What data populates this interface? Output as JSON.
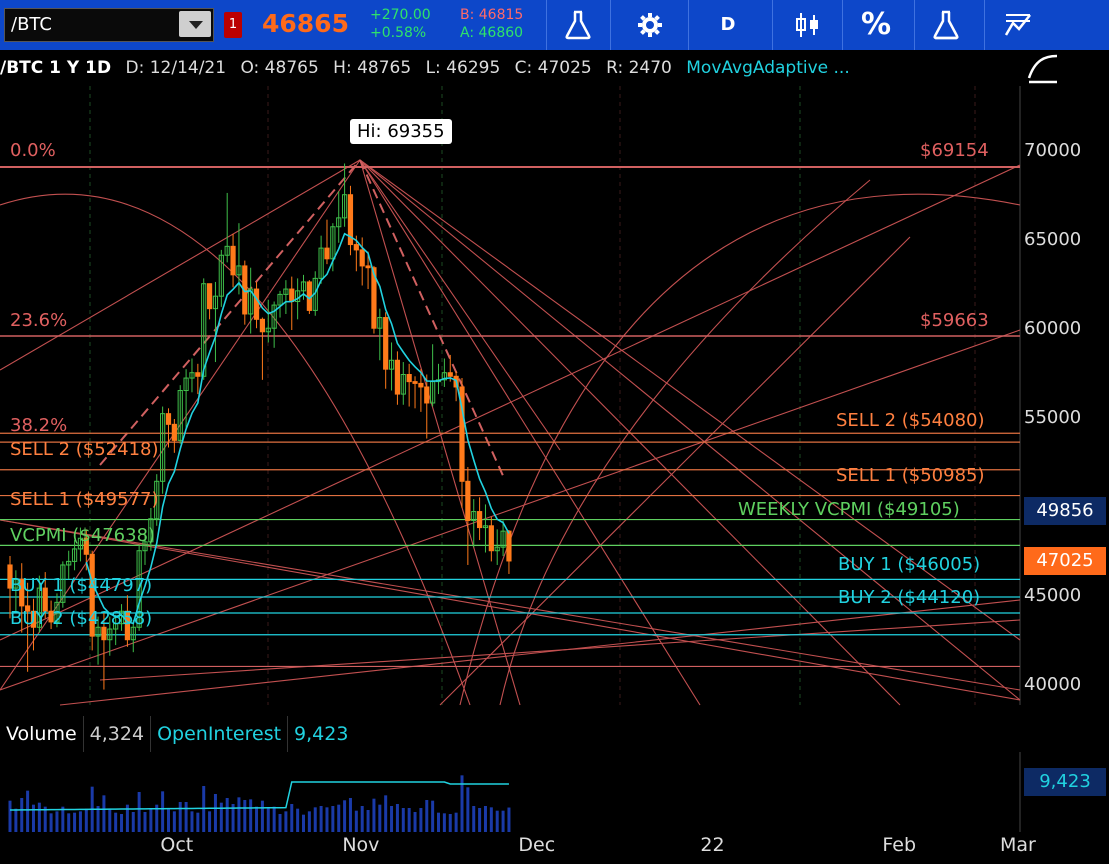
{
  "toolbar": {
    "symbol": "/BTC",
    "alert_badge": "1",
    "last_price": "46865",
    "net_change": "+270.00",
    "net_change_pct": "+0.58%",
    "bid": "B: 46815",
    "ask": "A: 46860",
    "aggregation": "D",
    "percent_label": "%",
    "accent": "#0d47c9",
    "price_color": "#ff6a1a",
    "change_color": "#2ee36a"
  },
  "infobar": {
    "symbol_period": "/BTC 1 Y 1D",
    "date": "D: 12/14/21",
    "open": "O: 48765",
    "high": "H: 48765",
    "low": "L: 46295",
    "close": "C: 47025",
    "range": "R: 2470",
    "study": "MovAvgAdaptive ..."
  },
  "price_tags": {
    "current": "47025",
    "current_color": "#ff6a1a",
    "weekly_vcpmi": "49856",
    "weekly_vcpmi_color": "#0d2a64"
  },
  "volume_panel": {
    "label": "Volume",
    "value": "4,324",
    "oi_label": "OpenInterest",
    "oi_value": "9,423",
    "oi_tag": "9,423"
  },
  "time_axis": [
    "Oct",
    "Nov",
    "Dec",
    "22",
    "Feb",
    "Mar"
  ],
  "tooltip": {
    "hi": "Hi: 69355"
  },
  "chart_data": {
    "type": "candlestick",
    "ylim": [
      38500,
      72000
    ],
    "y_ticks": [
      "70000",
      "65000",
      "60000",
      "55000",
      "50000",
      "45000",
      "40000"
    ],
    "start_date": "2021-09-03",
    "x_end_date": "2022-03-01",
    "candles": [
      [
        46800,
        47300,
        43800,
        45500
      ],
      [
        45500,
        46500,
        44200,
        46000
      ],
      [
        46000,
        46900,
        43000,
        44500
      ],
      [
        44500,
        45800,
        40800,
        44200
      ],
      [
        44200,
        44900,
        42000,
        43300
      ],
      [
        43300,
        46200,
        43000,
        45500
      ],
      [
        45500,
        46400,
        43800,
        44200
      ],
      [
        44200,
        44800,
        43200,
        43600
      ],
      [
        43600,
        45200,
        43300,
        44700
      ],
      [
        44700,
        47000,
        44400,
        46800
      ],
      [
        46800,
        47600,
        46000,
        47000
      ],
      [
        47000,
        48200,
        46500,
        47700
      ],
      [
        47700,
        48900,
        47000,
        48300
      ],
      [
        48300,
        48800,
        46500,
        47400
      ],
      [
        47400,
        47600,
        42000,
        42800
      ],
      [
        42800,
        43900,
        41200,
        43300
      ],
      [
        43300,
        44100,
        39800,
        42600
      ],
      [
        42600,
        43900,
        41700,
        43200
      ],
      [
        43200,
        44000,
        42300,
        43500
      ],
      [
        43500,
        44600,
        43100,
        44200
      ],
      [
        44200,
        45100,
        42200,
        42600
      ],
      [
        42600,
        43700,
        41900,
        43300
      ],
      [
        43300,
        47900,
        43100,
        47600
      ],
      [
        47600,
        48600,
        46800,
        48100
      ],
      [
        48100,
        50000,
        47600,
        49400
      ],
      [
        49400,
        51900,
        49000,
        51500
      ],
      [
        51500,
        55700,
        50800,
        55300
      ],
      [
        55300,
        55600,
        53400,
        54700
      ],
      [
        54700,
        55000,
        53100,
        53800
      ],
      [
        53800,
        56900,
        53600,
        56600
      ],
      [
        56600,
        57800,
        54500,
        57300
      ],
      [
        57300,
        58400,
        56500,
        57600
      ],
      [
        57600,
        58100,
        56400,
        57400
      ],
      [
        57400,
        62900,
        57200,
        62600
      ],
      [
        62600,
        62500,
        60600,
        61200
      ],
      [
        61200,
        62700,
        58200,
        61900
      ],
      [
        61900,
        64500,
        61300,
        64200
      ],
      [
        64200,
        67700,
        63800,
        64700
      ],
      [
        64700,
        65400,
        62400,
        63100
      ],
      [
        63100,
        66000,
        62000,
        63600
      ],
      [
        63600,
        63900,
        60300,
        60900
      ],
      [
        60900,
        63500,
        59800,
        62300
      ],
      [
        62300,
        62700,
        60100,
        60600
      ],
      [
        60600,
        60700,
        57200,
        59900
      ],
      [
        59900,
        61700,
        59300,
        60100
      ],
      [
        60100,
        61600,
        59000,
        61400
      ],
      [
        61400,
        62200,
        60700,
        62000
      ],
      [
        62000,
        62800,
        60900,
        62300
      ],
      [
        62300,
        63000,
        60000,
        61600
      ],
      [
        61600,
        62900,
        60600,
        62200
      ],
      [
        62200,
        63100,
        61700,
        62700
      ],
      [
        62700,
        62800,
        60900,
        61100
      ],
      [
        61100,
        63300,
        60800,
        62900
      ],
      [
        62900,
        65300,
        62600,
        64600
      ],
      [
        64600,
        66200,
        63700,
        64000
      ],
      [
        64000,
        66000,
        63300,
        65800
      ],
      [
        65800,
        67800,
        64900,
        66300
      ],
      [
        66300,
        69355,
        65800,
        67600
      ],
      [
        67600,
        68100,
        64200,
        64800
      ],
      [
        64800,
        65300,
        63300,
        64500
      ],
      [
        64500,
        65200,
        62500,
        63600
      ],
      [
        63600,
        64400,
        62300,
        63500
      ],
      [
        63500,
        63600,
        59800,
        60100
      ],
      [
        60100,
        61200,
        58300,
        60700
      ],
      [
        60700,
        61000,
        56700,
        57800
      ],
      [
        57800,
        59300,
        56600,
        58300
      ],
      [
        58300,
        58800,
        55800,
        56400
      ],
      [
        56400,
        58200,
        55800,
        57500
      ],
      [
        57500,
        58100,
        55700,
        57100
      ],
      [
        57100,
        57400,
        55600,
        57000
      ],
      [
        57000,
        57800,
        55400,
        56800
      ],
      [
        56800,
        57500,
        53900,
        55900
      ],
      [
        55900,
        59200,
        55700,
        57100
      ],
      [
        57100,
        58100,
        56400,
        57200
      ],
      [
        57200,
        58400,
        56800,
        57600
      ],
      [
        57600,
        58600,
        57100,
        57400
      ],
      [
        57400,
        57700,
        56000,
        56800
      ],
      [
        56800,
        57300,
        50000,
        51500
      ],
      [
        51500,
        52300,
        46800,
        49300
      ],
      [
        49300,
        50500,
        47800,
        49800
      ],
      [
        49800,
        50600,
        48200,
        48900
      ],
      [
        48900,
        50200,
        47500,
        49000
      ],
      [
        49000,
        49500,
        47000,
        47600
      ],
      [
        47600,
        48800,
        46800,
        47800
      ],
      [
        47800,
        49300,
        47300,
        48700
      ],
      [
        48700,
        48765,
        46295,
        47025
      ]
    ]
  }
}
